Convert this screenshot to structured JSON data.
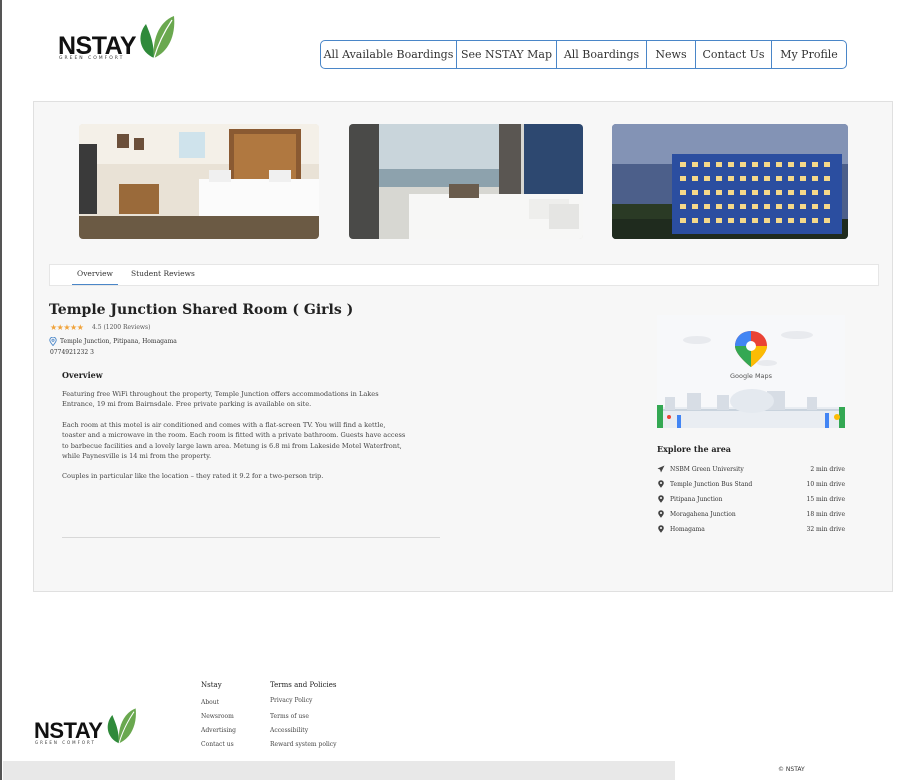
{
  "brand": {
    "name": "NSTAY",
    "tagline": "GREEN COMFORT"
  },
  "nav": {
    "items": [
      {
        "label": "All Available Boardings"
      },
      {
        "label": "See NSTAY Map"
      },
      {
        "label": "All Boardings"
      },
      {
        "label": "News"
      },
      {
        "label": "Contact Us"
      },
      {
        "label": "My Profile"
      }
    ]
  },
  "photos": [
    {
      "name": "hotel-room-photo"
    },
    {
      "name": "ocean-view-bedroom-photo"
    },
    {
      "name": "hotel-building-photo"
    }
  ],
  "tabs": {
    "overview": "Overview",
    "reviews": "Student Reviews",
    "active": "Overview"
  },
  "listing": {
    "title": "Temple Junction Shared Room ( Girls )",
    "stars": "★★★★★",
    "rating_value": 4.5,
    "rating_text": "4.5 (1200 Reviews)",
    "address": "Temple Junction, Pitipana, Homagama",
    "phone": "0774921232 3"
  },
  "overview": {
    "heading": "Overview",
    "p1": "Featuring free WiFi throughout the property, Temple Junction  offers accommodations in Lakes Entrance, 19 mi from Bairnsdale. Free private parking is available on site.",
    "p2": "Each room at this motel is air conditioned and comes with a flat-screen TV. You will find a kettle, toaster and a microwave in the room. Each room is fitted with a private bathroom. Guests have access to barbecue facilities and a lovely large lawn area. Metung is 6.8 mi from Lakeside Motel Waterfront, while Paynesville is 14 mi from the property.",
    "p3": "Couples in particular like the location – they rated it 9.2 for a two-person trip."
  },
  "map": {
    "label": "Google Maps"
  },
  "explore": {
    "heading": "Explore the area",
    "items": [
      {
        "icon": "airplane-icon",
        "name": "NSBM Green University",
        "distance": "2 min drive"
      },
      {
        "icon": "location-pin-icon",
        "name": "Temple Junction Bus Stand",
        "distance": "10 min drive"
      },
      {
        "icon": "location-pin-icon",
        "name": "Pitipana Junction",
        "distance": "15 min drive"
      },
      {
        "icon": "location-pin-icon",
        "name": "Moragahena Junction",
        "distance": "18 min drive"
      },
      {
        "icon": "location-pin-icon",
        "name": "Homagama",
        "distance": "32 min drive"
      }
    ]
  },
  "footer": {
    "col1": {
      "heading": "Nstay",
      "links": [
        "About",
        "Newsroom",
        "Advertising",
        "Contact us"
      ]
    },
    "col2": {
      "heading": "Terms and Policies",
      "links": [
        "Privacy Policy",
        "Terms of use",
        "Accessibility",
        "Reward system policy"
      ]
    },
    "copyright": "© NSTAY"
  },
  "colors": {
    "accent": "#4a86c8",
    "leaf": "#6aa84f",
    "star": "#f0a33b"
  }
}
